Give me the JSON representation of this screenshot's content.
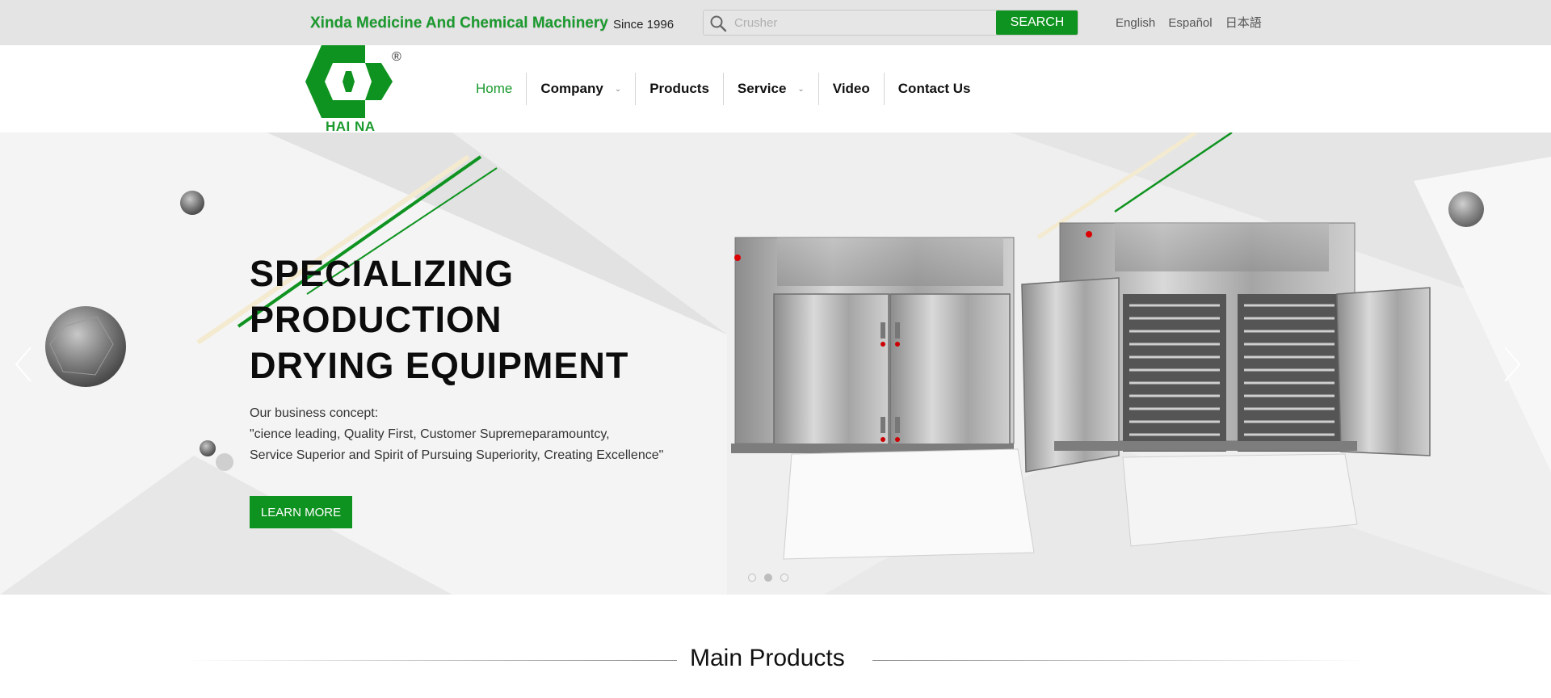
{
  "topbar": {
    "brand": "Xinda Medicine And Chemical Machinery",
    "since": "Since 1996",
    "search": {
      "placeholder": "Crusher",
      "button": "SEARCH"
    },
    "languages": [
      "English",
      "Español",
      "日本語"
    ]
  },
  "logo": {
    "text": "HAI NA",
    "registered": "®"
  },
  "nav": {
    "items": [
      {
        "label": "Home",
        "active": true
      },
      {
        "label": "Company",
        "dropdown": true
      },
      {
        "label": "Products"
      },
      {
        "label": "Service",
        "dropdown": true
      },
      {
        "label": "Video"
      },
      {
        "label": "Contact Us"
      }
    ],
    "caret": "⌄"
  },
  "hero": {
    "title_lines": [
      "SPECIALIZING",
      "PRODUCTION",
      "DRYING EQUIPMENT"
    ],
    "concept_lines": [
      "Our business concept:",
      "\"cience leading, Quality First, Customer Supremeparamountcy,",
      "Service Superior and Spirit of Pursuing Superiority, Creating Excellence\""
    ],
    "button": "LEARN MORE",
    "slides": 3,
    "active_slide": 2
  },
  "main_products": {
    "title": "Main Products"
  },
  "colors": {
    "brand_green": "#0f9320",
    "topbar_bg": "#e4e4e4",
    "hero_bg": "#efefef"
  }
}
